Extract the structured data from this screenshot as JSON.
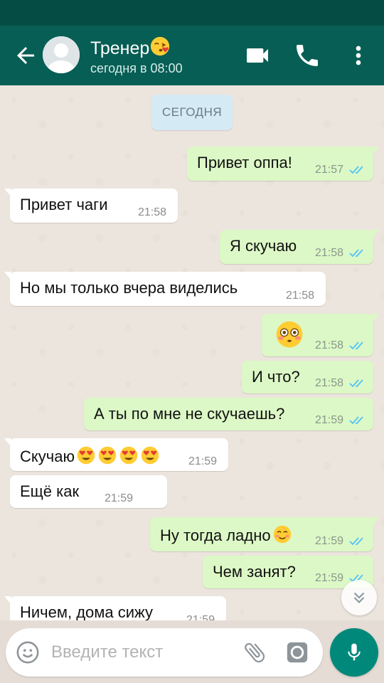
{
  "header": {
    "title": "Тренер",
    "subtitle": "сегодня в 08:00"
  },
  "chat": {
    "date_chip": "СЕГОДНЯ",
    "messages": [
      {
        "dir": "out",
        "text": "Привет оппа!",
        "time": "21:57"
      },
      {
        "dir": "in",
        "text": "Привет чаги",
        "time": "21:58"
      },
      {
        "dir": "out",
        "text": "Я скучаю",
        "time": "21:58"
      },
      {
        "dir": "in",
        "text": "Но мы только вчера виделись",
        "time": "21:58"
      },
      {
        "dir": "out",
        "text": "",
        "time": "21:58",
        "emoji": "flushed-face"
      },
      {
        "dir": "out",
        "text": "И что?",
        "time": "21:58"
      },
      {
        "dir": "out",
        "text": "А ты по мне не скучаешь?",
        "time": "21:59"
      },
      {
        "dir": "in",
        "text": "Скучаю",
        "time": "21:59",
        "emoji": "heart-eyes x4"
      },
      {
        "dir": "in",
        "text": "Ещё как",
        "time": "21:59"
      },
      {
        "dir": "out",
        "text": "Ну тогда ладно",
        "time": "21:59",
        "emoji": "smiling-face"
      },
      {
        "dir": "out",
        "text": "Чем занят?",
        "time": "21:59"
      },
      {
        "dir": "in",
        "text": "Ничем, дома сижу",
        "time": "21:59"
      }
    ]
  },
  "input": {
    "placeholder": "Введите текст",
    "value": ""
  },
  "colors": {
    "header": "#075e54",
    "status_bar": "#054d44",
    "outgoing_bubble": "#dcf8c6",
    "incoming_bubble": "#ffffff",
    "read_ticks": "#4fc3f7",
    "mic_button": "#00897b"
  },
  "icons": {
    "header": [
      "back-arrow-icon",
      "avatar-placeholder-icon",
      "kissing-face-emoji",
      "video-call-icon",
      "phone-icon",
      "more-vert-icon"
    ],
    "input": [
      "emoji-icon",
      "attach-icon",
      "camera-icon",
      "mic-icon"
    ],
    "chat": [
      "double-check-icon",
      "scroll-down-icon"
    ]
  }
}
